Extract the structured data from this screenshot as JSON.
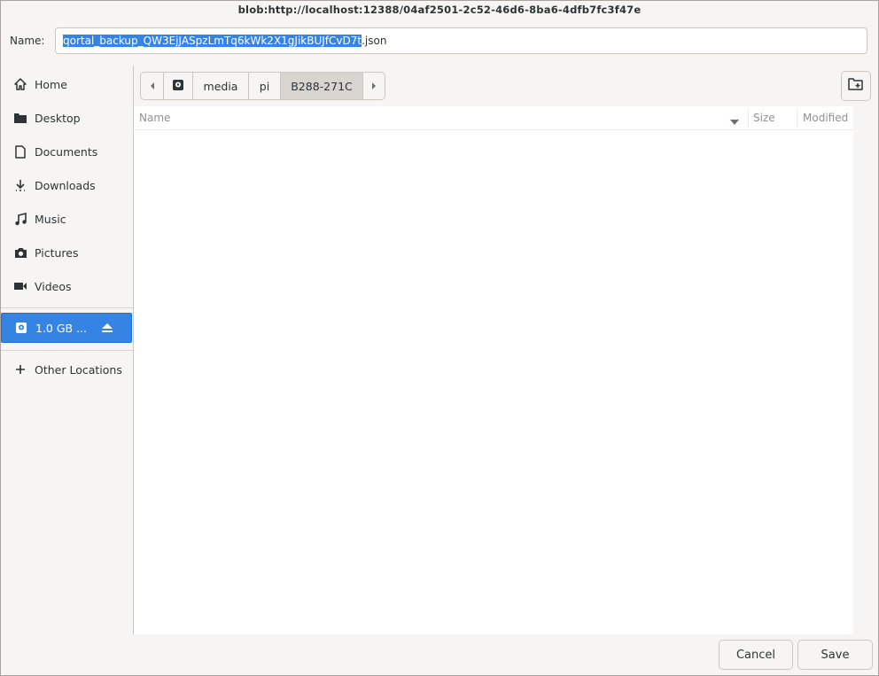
{
  "window": {
    "title": "blob:http://localhost:12388/04af2501-2c52-46d6-8ba6-4dfb7fc3f47e"
  },
  "name_field": {
    "label": "Name:",
    "selected_text": "qortal_backup_QW3EjJASpzLmTq6kWk2X1gJikBUJfCvD7t",
    "extension": ".json"
  },
  "sidebar": {
    "places": [
      {
        "label": "Home",
        "icon": "home-icon"
      },
      {
        "label": "Desktop",
        "icon": "folder-icon"
      },
      {
        "label": "Documents",
        "icon": "document-icon"
      },
      {
        "label": "Downloads",
        "icon": "download-icon"
      },
      {
        "label": "Music",
        "icon": "music-icon"
      },
      {
        "label": "Pictures",
        "icon": "camera-icon"
      },
      {
        "label": "Videos",
        "icon": "video-icon"
      }
    ],
    "device": {
      "label": "1.0 GB ...",
      "icon": "drive-icon"
    },
    "other": {
      "label": "Other Locations",
      "icon": "plus-icon"
    }
  },
  "pathbar": {
    "segments": [
      "media",
      "pi",
      "B288-271C"
    ]
  },
  "columns": {
    "name": "Name",
    "size": "Size",
    "modified": "Modified"
  },
  "footer": {
    "cancel": "Cancel",
    "save": "Save"
  },
  "colors": {
    "accent": "#3584e4",
    "background": "#f6f5f4",
    "border": "#cdc7c2"
  }
}
